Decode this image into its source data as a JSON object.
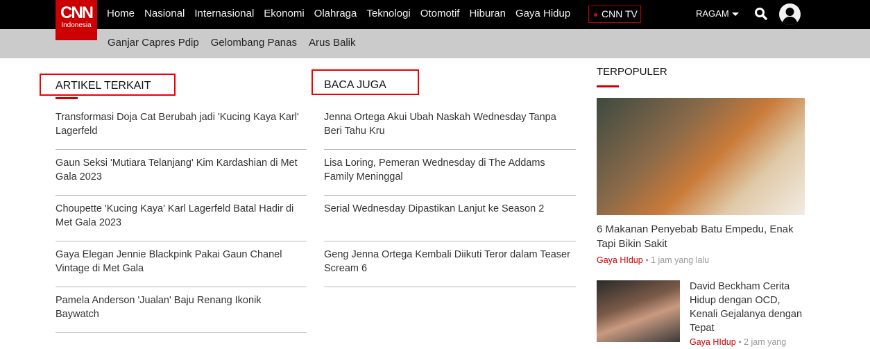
{
  "header": {
    "logo_main": "CNN",
    "logo_sub": "Indonesia",
    "nav": [
      "Home",
      "Nasional",
      "Internasional",
      "Ekonomi",
      "Olahraga",
      "Teknologi",
      "Otomotif",
      "Hiburan",
      "Gaya Hidup"
    ],
    "cnn_tv": "CNN TV",
    "ragam": "RAGAM"
  },
  "subnav": [
    "Ganjar Capres Pdip",
    "Gelombang Panas",
    "Arus Balik"
  ],
  "artikel_terkait": {
    "title": "ARTIKEL TERKAIT",
    "items": [
      "Transformasi Doja Cat Berubah jadi 'Kucing Kaya Karl' Lagerfeld",
      "Gaun Seksi 'Mutiara Telanjang' Kim Kardashian di Met Gala 2023",
      "Choupette 'Kucing Kaya' Karl Lagerfeld Batal Hadir di Met Gala 2023",
      "Gaya Elegan Jennie Blackpink Pakai Gaun Chanel Vintage di Met Gala",
      "Pamela Anderson 'Jualan' Baju Renang Ikonik Baywatch"
    ]
  },
  "baca_juga": {
    "title": "BACA JUGA",
    "items": [
      "Jenna Ortega Akui Ubah Naskah Wednesday Tanpa Beri Tahu Kru",
      "Lisa Loring, Pemeran Wednesday di The Addams Family Meninggal",
      "Serial Wednesday Dipastikan Lanjut ke Season 2",
      "Geng Jenna Ortega Kembali Diikuti Teror dalam Teaser Scream 6"
    ]
  },
  "terpopuler": {
    "title": "TERPOPULER",
    "items": [
      {
        "title": "6 Makanan Penyebab Batu Empedu, Enak Tapi Bikin Sakit",
        "category": "Gaya HIdup",
        "time": "1 jam yang lalu"
      },
      {
        "title": "David Beckham Cerita Hidup dengan OCD, Kenali Gejalanya dengan Tepat",
        "category": "Gaya HIdup",
        "time": "2 jam yang"
      }
    ]
  }
}
